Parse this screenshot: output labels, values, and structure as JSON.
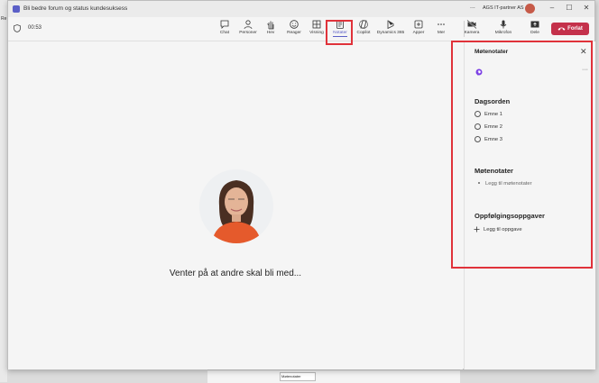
{
  "window": {
    "title": "Bli bedre forum og status kundesuksess",
    "more_label": "...",
    "user_name": "AGS IT-partner AS",
    "minimize": "–",
    "maximize": "☐",
    "close": "✕"
  },
  "meeting": {
    "timer": "00:53",
    "tools": [
      {
        "label": "Chat",
        "icon": "chat-icon"
      },
      {
        "label": "Personer",
        "icon": "people-icon"
      },
      {
        "label": "Hev",
        "icon": "raise-hand-icon"
      },
      {
        "label": "Reager",
        "icon": "react-emoji-icon"
      },
      {
        "label": "Visning",
        "icon": "view-grid-icon"
      },
      {
        "label": "Notater",
        "icon": "notes-icon",
        "active": true
      },
      {
        "label": "Copilot",
        "icon": "copilot-icon"
      },
      {
        "label": "Dynamics 365",
        "icon": "dynamics-icon"
      },
      {
        "label": "Apper",
        "icon": "apps-plus-icon"
      },
      {
        "label": "Mer",
        "icon": "more-icon"
      },
      {
        "label": "Kamera",
        "icon": "camera-off-icon"
      },
      {
        "label": "Mikrofon",
        "icon": "microphone-icon"
      },
      {
        "label": "Dele",
        "icon": "share-icon"
      }
    ],
    "leave_label": "Forlat",
    "waiting_text": "Venter på at andre skal bli med..."
  },
  "notes_panel": {
    "title": "Møtenotater",
    "more": "···",
    "agenda_title": "Dagsorden",
    "agenda_items": [
      "Emne 1",
      "Emne 2",
      "Emne 3"
    ],
    "notes_title": "Møtenotater",
    "notes_placeholder": "Legg til møtenotater",
    "tasks_title": "Oppfølgingsoppgaver",
    "add_task_label": "Legg til oppgave"
  },
  "taskbar_doc_label": "Møtenotater",
  "colors": {
    "accent": "#5b5fc7",
    "leave": "#c4314b",
    "highlight": "#e0323a"
  }
}
